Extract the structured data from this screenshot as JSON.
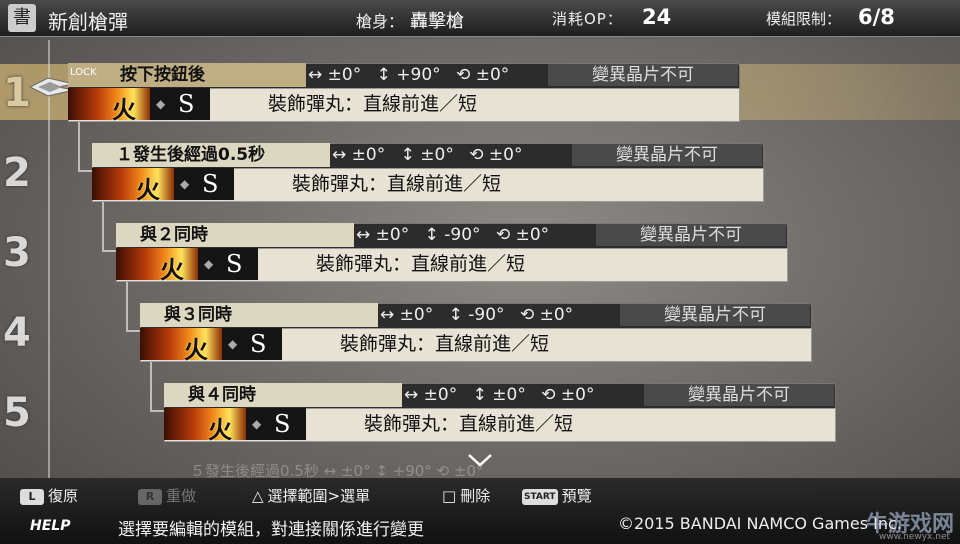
{
  "header": {
    "icon_glyph": "書",
    "title": "新創槍彈",
    "gun_label": "槍身：",
    "gun_value": "轟擊槍",
    "op_label": "消耗OP：",
    "op_value": "24",
    "limit_label": "模組限制：",
    "limit_value": "6/8"
  },
  "lock_tag": "LOCK",
  "row_numbers": [
    "1",
    "2",
    "3",
    "4",
    "5"
  ],
  "modules": [
    {
      "condition": "按下按鈕後",
      "h_angle": "↔ ±0°",
      "v_angle": "↕ +90°",
      "r_angle": "⟲ ±0°",
      "mutation": "變異晶片不可",
      "element": "火",
      "size": "S",
      "bullet": "裝飾彈丸：直線前進／短"
    },
    {
      "condition": "１發生後經過0.5秒",
      "h_angle": "↔ ±0°",
      "v_angle": "↕ ±0°",
      "r_angle": "⟲ ±0°",
      "mutation": "變異晶片不可",
      "element": "火",
      "size": "S",
      "bullet": "裝飾彈丸：直線前進／短"
    },
    {
      "condition": "與２同時",
      "h_angle": "↔ ±0°",
      "v_angle": "↕ -90°",
      "r_angle": "⟲ ±0°",
      "mutation": "變異晶片不可",
      "element": "火",
      "size": "S",
      "bullet": "裝飾彈丸：直線前進／短"
    },
    {
      "condition": "與３同時",
      "h_angle": "↔ ±0°",
      "v_angle": "↕ -90°",
      "r_angle": "⟲ ±0°",
      "mutation": "變異晶片不可",
      "element": "火",
      "size": "S",
      "bullet": "裝飾彈丸：直線前進／短"
    },
    {
      "condition": "與４同時",
      "h_angle": "↔ ±0°",
      "v_angle": "↕ ±0°",
      "r_angle": "⟲ ±0°",
      "mutation": "變異晶片不可",
      "element": "火",
      "size": "S",
      "bullet": "裝飾彈丸：直線前進／短"
    }
  ],
  "ghost_row": "５發生後經過0.5秒 ↔ ±0° ↕ +90° ⟲ ±0°",
  "controls": {
    "l_glyph": "L",
    "l_label": "復原",
    "r_glyph": "R",
    "r_label": "重做",
    "tri_glyph": "△",
    "tri_label": "選擇範圍>選單",
    "sq_glyph": "□",
    "sq_label": "刪除",
    "start_glyph": "START",
    "start_label": "預覽"
  },
  "help_label": "HELP",
  "hint": "選擇要編輯的模組，對連接關係進行變更",
  "copyright": "©2015 BANDAI NAMCO Games Inc.",
  "watermark": "牛游戏网",
  "watermark_url": "www.newyx.net"
}
